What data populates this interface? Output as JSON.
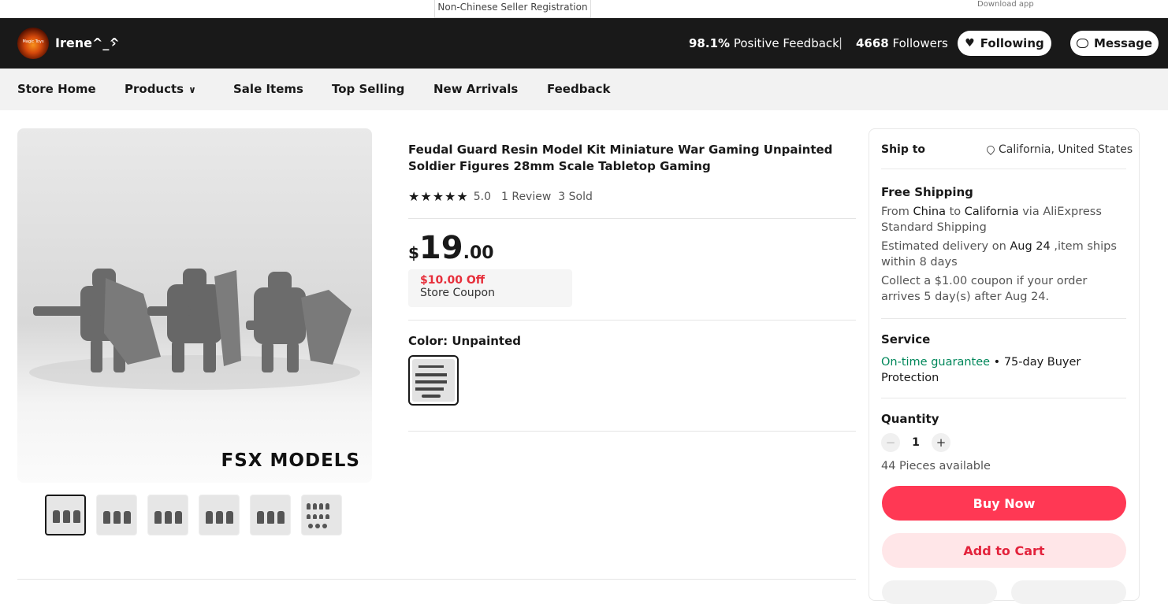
{
  "top": {
    "seller_registration": "Non-Chinese Seller Registration",
    "download_app": "Download app"
  },
  "store": {
    "avatar_text": "Magic Toys",
    "name": "Irene^_^",
    "feedback_pct": "98.1%",
    "feedback_label": "Positive Feedback",
    "followers_count": "4668",
    "followers_label": "Followers",
    "following_label": "Following",
    "message_label": "Message"
  },
  "nav": {
    "items": [
      "Store Home",
      "Products",
      "Sale Items",
      "Top Selling",
      "New Arrivals",
      "Feedback"
    ]
  },
  "product": {
    "image_watermark": "FSX MODELS",
    "title": "Feudal Guard Resin Model Kit Miniature War Gaming Unpainted Soldier Figures 28mm Scale Tabletop Gaming",
    "stars": "★★★★★",
    "rating": "5.0",
    "reviews": "1 Review",
    "sold": "3 Sold",
    "price_currency": "$",
    "price_int": "19",
    "price_dec": ".00",
    "coupon_off": "$10.00 Off",
    "coupon_type": "Store Coupon",
    "color_label": "Color: Unpainted",
    "thumbnail_count": 6
  },
  "shipping": {
    "ship_to_label": "Ship to",
    "location": "California, United States",
    "free_shipping": "Free Shipping",
    "from_prefix": "From ",
    "from_country": "China",
    "to_word": " to ",
    "to_region": "California",
    "via_text": " via AliExpress Standard Shipping",
    "est_prefix": "Estimated delivery on ",
    "est_date": "Aug 24",
    "est_suffix": " ,item ships within 8 days",
    "coupon_note": "Collect a $1.00 coupon if your order arrives 5 day(s) after Aug 24."
  },
  "service": {
    "title": "Service",
    "guarantee": "On-time guarantee",
    "bullet": " • 75-day Buyer Protection"
  },
  "quantity": {
    "title": "Quantity",
    "minus": "−",
    "value": "1",
    "plus": "+",
    "available": "44 Pieces available"
  },
  "actions": {
    "buy_now": "Buy Now",
    "add_to_cart": "Add to Cart"
  },
  "colors": {
    "accent": "#ff3854",
    "coupon_red": "#e62e3a",
    "guarantee_green": "#00875a",
    "header_bg": "#191919"
  }
}
